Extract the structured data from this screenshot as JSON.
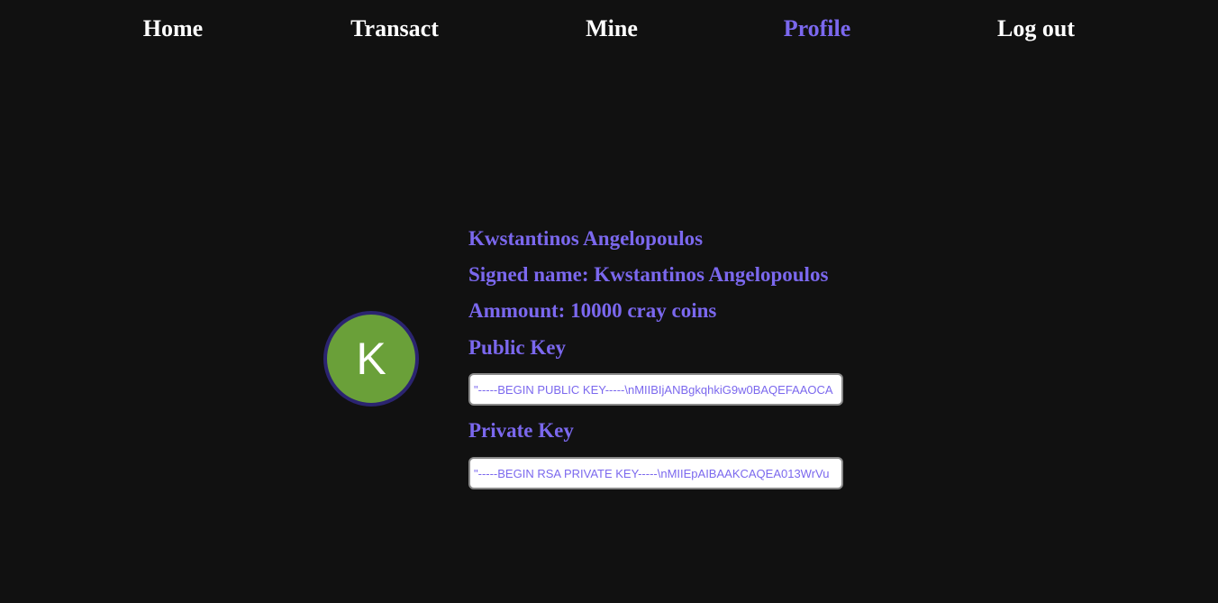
{
  "nav": {
    "home": "Home",
    "transact": "Transact",
    "mine": "Mine",
    "profile": "Profile",
    "logout": "Log out"
  },
  "profile": {
    "avatar_letter": "K",
    "full_name": "Kwstantinos Angelopoulos",
    "signed_name": "Signed name: Kwstantinos Angelopoulos",
    "amount": "Ammount: 10000 cray coins",
    "public_key_label": "Public Key",
    "public_key_value": "\"-----BEGIN PUBLIC KEY-----\\nMIIBIjANBgkqhkiG9w0BAQEFAAOCA",
    "private_key_label": "Private Key",
    "private_key_value": "\"-----BEGIN RSA PRIVATE KEY-----\\nMIIEpAIBAAKCAQEA013WrVu"
  },
  "colors": {
    "accent": "#7b68ee",
    "background": "#111111",
    "avatar_fill": "#6aa039",
    "avatar_border": "#2b2470"
  }
}
